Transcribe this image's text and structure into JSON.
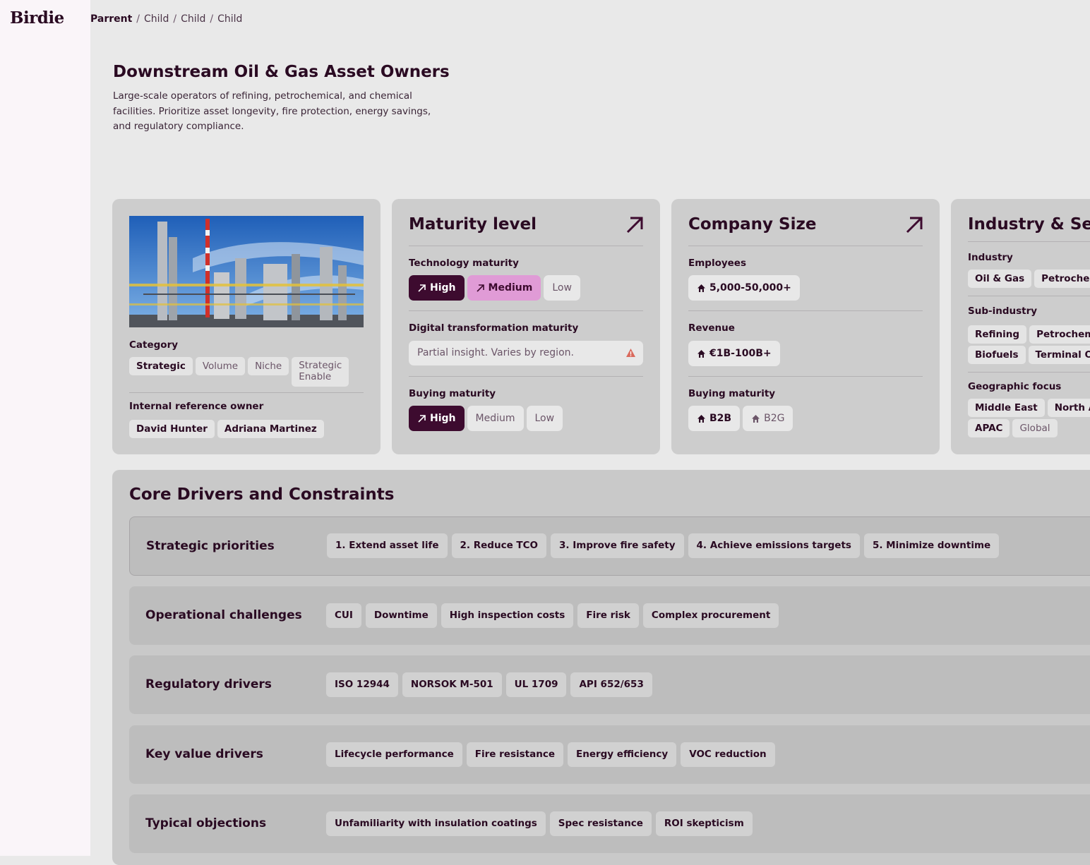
{
  "app": {
    "logo": "Birdie"
  },
  "breadcrumb": [
    "Parrent",
    "Child",
    "Child",
    "Child"
  ],
  "page": {
    "title": "Downstream Oil & Gas Asset Owners",
    "description": "Large-scale operators of refining, petrochemical, and chemical facilities. Prioritize asset longevity, fire protection, energy savings, and regulatory compliance."
  },
  "overview": {
    "category_label": "Category",
    "categories": [
      {
        "label": "Strategic",
        "selected": true
      },
      {
        "label": "Volume",
        "selected": false
      },
      {
        "label": "Niche",
        "selected": false
      },
      {
        "label": "Strategic\nEnable",
        "selected": false
      }
    ],
    "owner_label": "Internal reference owner",
    "owners": [
      "David Hunter",
      "Adriana Martinez"
    ]
  },
  "maturity": {
    "title": "Maturity level",
    "tech_label": "Technology maturity",
    "tech_options": [
      "High",
      "Medium",
      "Low"
    ],
    "digital_label": "Digital transformation maturity",
    "digital_value": "Partial insight. Varies by region.",
    "buying_label": "Buying maturity",
    "buying_options": [
      "High",
      "Medium",
      "Low"
    ]
  },
  "company_size": {
    "title": "Company Size",
    "employees_label": "Employees",
    "employees_value": "5,000-50,000+",
    "revenue_label": "Revenue",
    "revenue_value": "€1B-100B+",
    "buying_label": "Buying maturity",
    "buying_options": [
      "B2B",
      "B2G"
    ]
  },
  "industry": {
    "title": "Industry & Segment",
    "industry_label": "Industry",
    "industries": [
      "Oil & Gas",
      "Petrochemical"
    ],
    "subindustry_label": "Sub-industry",
    "subindustries_row1": [
      "Refining",
      "Petrochemical"
    ],
    "subindustries_row2": [
      "Biofuels",
      "Terminal Operations"
    ],
    "geo_label": "Geographic focus",
    "geo_row1": [
      "Middle East",
      "North America"
    ],
    "geo_row2": [
      "APAC",
      "Global"
    ]
  },
  "core": {
    "title": "Core Drivers and Constraints",
    "rows": [
      {
        "label": "Strategic priorities",
        "tags": [
          "1. Extend asset life",
          "2. Reduce TCO",
          "3. Improve fire safety",
          "4. Achieve emissions targets",
          "5. Minimize downtime"
        ]
      },
      {
        "label": "Operational challenges",
        "tags": [
          "CUI",
          "Downtime",
          "High inspection costs",
          "Fire risk",
          "Complex procurement"
        ]
      },
      {
        "label": "Regulatory drivers",
        "tags": [
          "ISO 12944",
          "NORSOK M-501",
          "UL 1709",
          "API 652/653"
        ]
      },
      {
        "label": "Key value drivers",
        "tags": [
          "Lifecycle performance",
          "Fire resistance",
          "Energy efficiency",
          "VOC reduction"
        ]
      },
      {
        "label": "Typical objections",
        "tags": [
          "Unfamiliarity with insulation coatings",
          "Spec resistance",
          "ROI skepticism"
        ]
      }
    ]
  },
  "colors": {
    "accent": "#3d0b2f",
    "accent_pink": "#e09bd6",
    "page_bg": "#e9e9e9",
    "card_bg": "#cdcdcd",
    "sidebar_bg": "#faf5f9",
    "warning": "#d9695c"
  },
  "icons": {
    "card_link": "arrow-up-right-icon",
    "size_marker": "house-icon",
    "digital_warning": "warning-triangle-icon"
  }
}
